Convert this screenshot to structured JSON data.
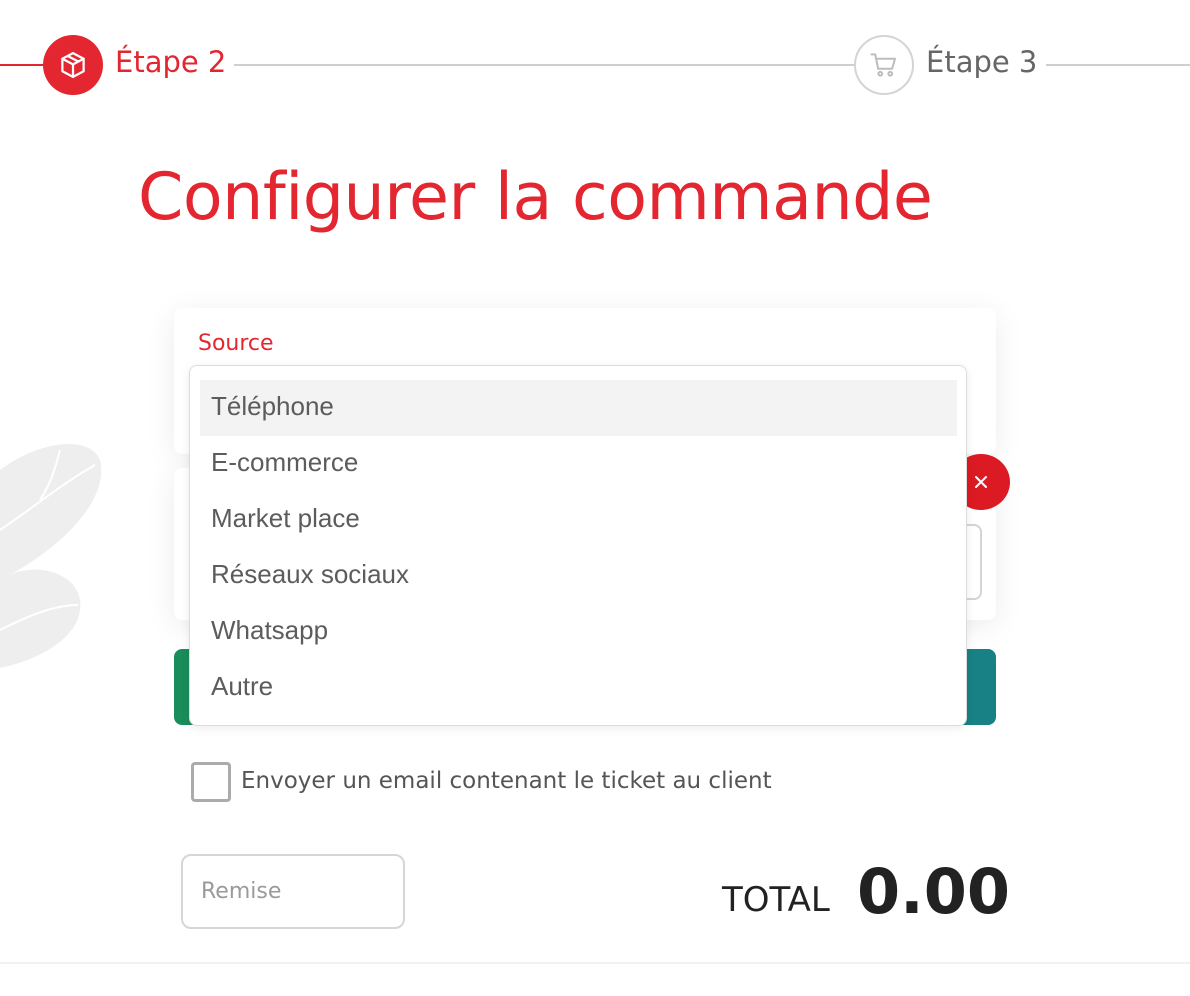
{
  "stepper": {
    "step2": {
      "label": "Étape 2",
      "icon": "package-icon",
      "state": "active"
    },
    "step3": {
      "label": "Étape 3",
      "icon": "cart-icon",
      "state": "inactive"
    }
  },
  "page": {
    "title": "Configurer la commande"
  },
  "source": {
    "label": "Source",
    "options": [
      "Téléphone",
      "E-commerce",
      "Market place",
      "Réseaux sociaux",
      "Whatsapp",
      "Autre"
    ],
    "highlighted": "Téléphone"
  },
  "email_checkbox": {
    "label": "Envoyer un email contenant le ticket au client",
    "checked": false
  },
  "remise": {
    "placeholder": "Remise",
    "value": ""
  },
  "total": {
    "label": "TOTAL",
    "value": "0.00"
  },
  "colors": {
    "accent": "#e3262f",
    "remove": "#dc1a23",
    "bar_start": "#1a8d59",
    "bar_end": "#178186"
  }
}
